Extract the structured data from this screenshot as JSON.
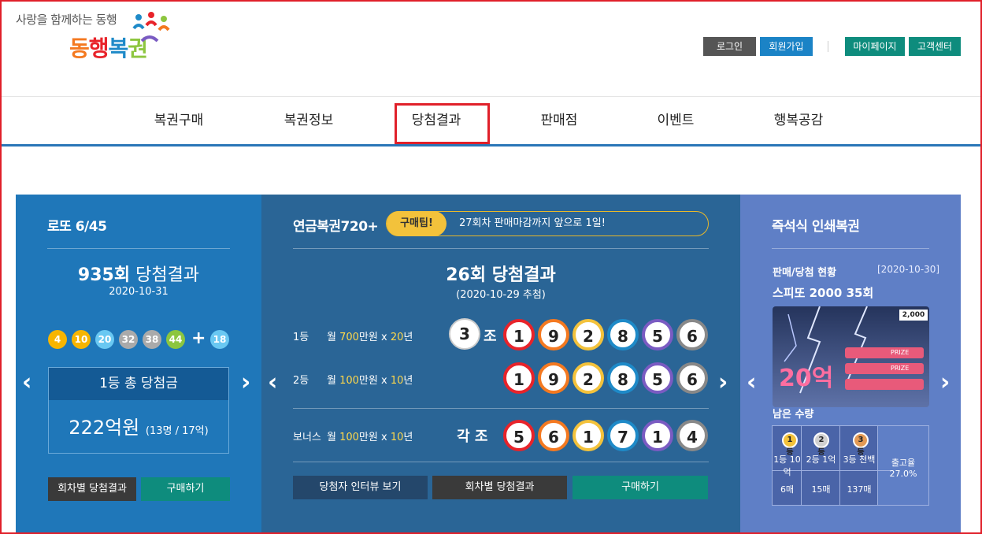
{
  "header": {
    "tagline": "사랑을 함께하는 동행",
    "brand_parts": [
      "동",
      "행",
      "복",
      "권"
    ],
    "login": "로그인",
    "join": "회원가입",
    "mypage": "마이페이지",
    "customer": "고객센터"
  },
  "nav": [
    "복권구매",
    "복권정보",
    "당첨결과",
    "판매점",
    "이벤트",
    "행복공감"
  ],
  "lotto": {
    "title": "로또 6/45",
    "round_num": "935회",
    "round_suffix": " 당첨결과",
    "date": "2020-10-31",
    "numbers": [
      "4",
      "10",
      "20",
      "32",
      "38",
      "44"
    ],
    "plus": "+",
    "bonus": "18",
    "ball_colors": [
      "#f7b500",
      "#f7b500",
      "#69c8f2",
      "#aaaaaa",
      "#aaaaaa",
      "#8cc63f"
    ],
    "bonus_color": "#69c8f2",
    "prize_label": "1등 총 당첨금",
    "prize_amount": "222억원",
    "prize_detail": "(13명 / 17억)",
    "btn_history": "회차별 당첨결과",
    "btn_buy": "구매하기"
  },
  "pension": {
    "title": "연금복권720+",
    "tip_label": "구매팁!",
    "tip_text": "27회차 판매마감까지 앞으로 1일!",
    "round": "26회 당첨결과",
    "date": "(2020-10-29 추첨)",
    "rank1_label": "1등",
    "rank1_pre": "월 ",
    "rank1_amount": "700",
    "rank1_unit": "만원 x ",
    "rank1_years": "20",
    "rank1_years_unit": "년",
    "group": "3",
    "jo": "조",
    "rank1_numbers": [
      "1",
      "9",
      "2",
      "8",
      "5",
      "6"
    ],
    "rank2_label": "2등",
    "rank2_pre": "월 ",
    "rank2_amount": "100",
    "rank2_unit": "만원 x ",
    "rank2_years": "10",
    "rank2_years_unit": "년",
    "rank2_numbers": [
      "1",
      "9",
      "2",
      "8",
      "5",
      "6"
    ],
    "bonus_label": "보너스",
    "bonus_pre": "월 ",
    "bonus_amount": "100",
    "bonus_unit": "만원 x ",
    "bonus_years": "10",
    "bonus_years_unit": "년",
    "each_group": "각 조",
    "bonus_numbers": [
      "5",
      "6",
      "1",
      "7",
      "1",
      "4"
    ],
    "digit_ring_colors": [
      "#e8232a",
      "#f47920",
      "#f3c23b",
      "#1e8ac8",
      "#7a5bc2",
      "#888888"
    ],
    "btn_interview": "당첨자 인터뷰 보기",
    "btn_history": "회차별 당첨결과",
    "btn_buy": "구매하기"
  },
  "instant": {
    "title": "즉석식 인쇄복권",
    "status_label": "판매/당첨 현황",
    "status_date": "[2020-10-30]",
    "product": "스피또 2000 35회",
    "ticket_price": "2,000",
    "ticket_prize": "20억",
    "ticket_prize_tag": "PRIZE",
    "remaining": "남은 수량",
    "tiers": [
      {
        "badge": "1등",
        "label": "1등 10억",
        "count": "6매"
      },
      {
        "badge": "2등",
        "label": "2등 1억",
        "count": "15매"
      },
      {
        "badge": "3등",
        "label": "3등 천백",
        "count": "137매"
      }
    ],
    "rate_label": "출고율",
    "rate_value": "27.0%"
  }
}
